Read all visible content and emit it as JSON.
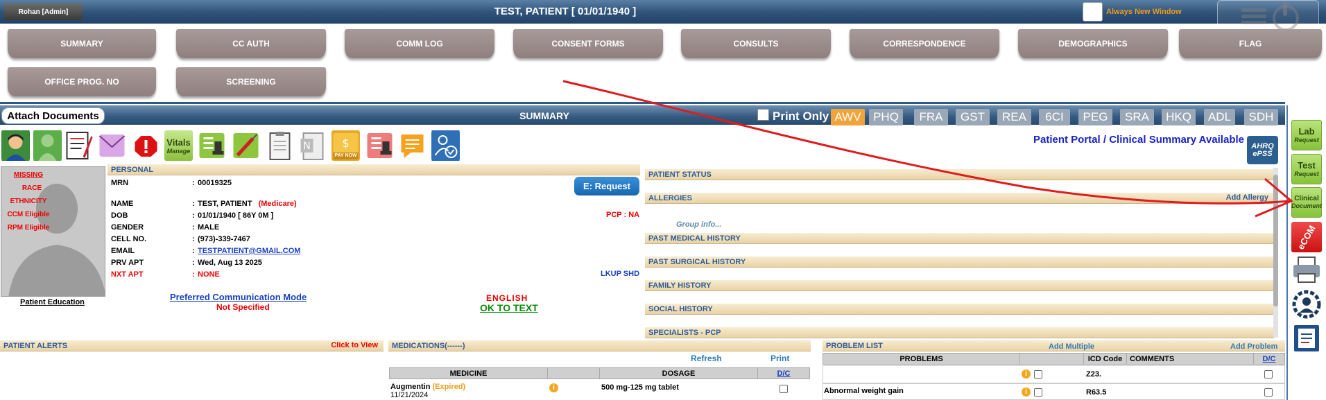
{
  "header": {
    "user": "Rohan [Admin]",
    "patient_title": "TEST, PATIENT [ 01/01/1940 ]",
    "always_new_window": "Always New Window"
  },
  "tabs": [
    {
      "label": "SUMMARY"
    },
    {
      "label": "CC AUTH"
    },
    {
      "label": "COMM LOG"
    },
    {
      "label": "CONSENT FORMS"
    },
    {
      "label": "CONSULTS"
    },
    {
      "label": "CORRESPONDENCE"
    },
    {
      "label": "DEMOGRAPHICS"
    },
    {
      "label": "FLAG"
    },
    {
      "label": "OFFICE PROG. NO"
    },
    {
      "label": "SCREENING"
    }
  ],
  "summary_bar": {
    "attach_documents": "Attach Documents",
    "title": "SUMMARY",
    "print_only": "Print Only",
    "assessments": [
      "AWV",
      "PHQ",
      "FRA",
      "GST",
      "REA",
      "6CI",
      "PEG",
      "SRA",
      "HKQ",
      "ADL",
      "SDH"
    ],
    "active_assessment": "AWV"
  },
  "toolbar": {
    "vitals": "Vitals",
    "manage": "Manage",
    "paynow": "PAY NOW",
    "n_letter": "N"
  },
  "portal_text": "Patient Portal / Clinical Summary Available",
  "ahrq": {
    "line1": "AHRQ",
    "line2": "ePSS"
  },
  "missing_block": {
    "missing": "MISSING",
    "race": "RACE",
    "ethnicity": "ETHNICITY",
    "ccm": "CCM Eligible",
    "rpm": "RPM Eligible"
  },
  "patient_education": "Patient Education",
  "personal": {
    "header": "PERSONAL",
    "rows": [
      {
        "label": "MRN",
        "value": "00019325"
      },
      {
        "label": "NAME",
        "value": "TEST, PATIENT",
        "extra": "(Medicare)"
      },
      {
        "label": "DOB",
        "value": "01/01/1940 [ 86Y 0M ]"
      },
      {
        "label": "GENDER",
        "value": "MALE"
      },
      {
        "label": "CELL NO.",
        "value": "(973)-339-7467"
      },
      {
        "label": "EMAIL",
        "value": "TESTPATIENT@GMAIL.COM"
      },
      {
        "label": "PRV APT",
        "value": "Wed, Aug 13 2025"
      },
      {
        "label": "NXT APT",
        "value": "NONE"
      }
    ],
    "colon": ":",
    "e_request": "E: Request",
    "pcp": "PCP : NA",
    "lkup": "LKUP SHD",
    "pref_comm": "Preferred Communication Mode",
    "not_specified": "Not Specified",
    "language": "ENGLISH",
    "ok_to_text": "OK TO TEXT"
  },
  "right_sections": {
    "patient_status": "PATIENT STATUS",
    "allergies": "ALLERGIES",
    "add_allergy": "Add Allergy",
    "group_info": "Group info...",
    "past_medical": "PAST MEDICAL HISTORY",
    "past_surgical": "PAST SURGICAL HISTORY",
    "family": "FAMILY HISTORY",
    "social": "SOCIAL HISTORY",
    "specialists": "SPECIALISTS - PCP"
  },
  "side_buttons": {
    "lab": {
      "big": "Lab",
      "small": "Request"
    },
    "test": {
      "big": "Test",
      "small": "Request"
    },
    "clinical": {
      "big": "Clinical",
      "small": "Document"
    },
    "ecom": "eCOM"
  },
  "alerts": {
    "header": "PATIENT ALERTS",
    "click_to_view": "Click to View"
  },
  "medications": {
    "header": "MEDICATIONS(------)",
    "refresh": "Refresh",
    "print": "Print",
    "col_medicine": "MEDICINE",
    "col_dosage": "DOSAGE",
    "col_dc": "D/C",
    "rows": [
      {
        "name": "Augmentin",
        "status": "(Expired)",
        "date": "11/21/2024",
        "dosage": "500 mg-125 mg tablet"
      }
    ]
  },
  "problems": {
    "header": "PROBLEM LIST",
    "add_multiple": "Add Multiple",
    "add_problem": "Add Problem",
    "col_problems": "PROBLEMS",
    "col_icd": "ICD Code",
    "col_comments": "COMMENTS",
    "col_dc": "D/C",
    "rows": [
      {
        "problem": "",
        "icd": "Z23."
      },
      {
        "problem": "Abnormal weight gain",
        "icd": "R63.5"
      }
    ]
  },
  "colors": {
    "header_blue": "#2e5278",
    "tab_mauve": "#9b8b8b",
    "section_tan": "#e9d3a4",
    "section_text": "#2e5b9a",
    "alert_red": "#e00000",
    "link_blue": "#1a40c0",
    "orange": "#f29b1c"
  }
}
